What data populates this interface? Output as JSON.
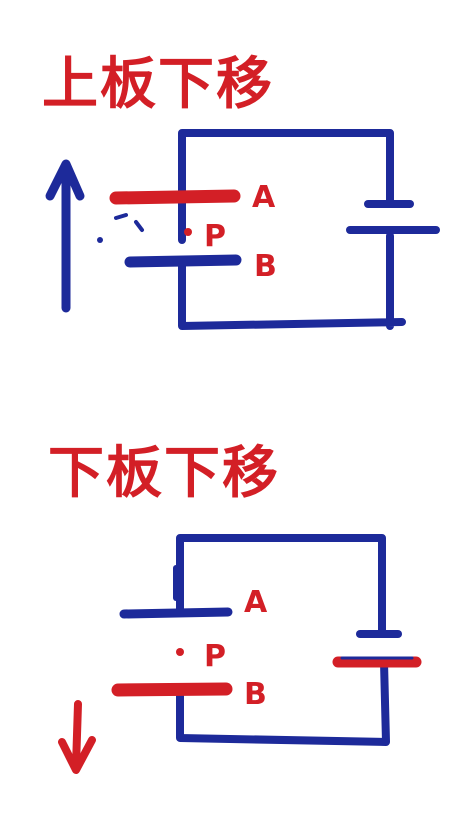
{
  "colors": {
    "red": "#d31f26",
    "blue": "#1d2a9a",
    "background": "#ffffff"
  },
  "diagram_top": {
    "title": "上板下移",
    "label_a": "A",
    "label_b": "B",
    "label_p": "P",
    "arrow": "arrow-up-icon"
  },
  "diagram_bottom": {
    "title": "下板下移",
    "label_a": "A",
    "label_b": "B",
    "label_p": "P",
    "arrow": "arrow-down-icon"
  }
}
